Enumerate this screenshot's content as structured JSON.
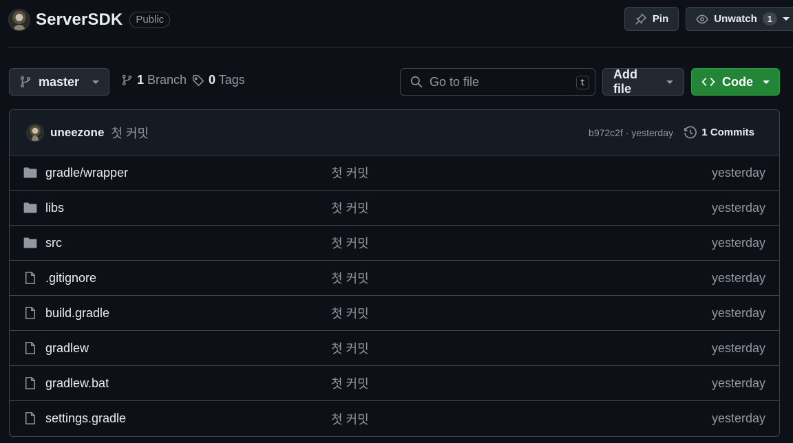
{
  "repo": {
    "name": "ServerSDK",
    "visibility": "Public"
  },
  "header_actions": {
    "pin_label": "Pin",
    "unwatch_label": "Unwatch",
    "watch_count": "1"
  },
  "toolbar": {
    "branch_name": "master",
    "branch_count": "1",
    "branch_label": "Branch",
    "tag_count": "0",
    "tag_label": "Tags",
    "goto_placeholder": "Go to file",
    "goto_shortcut": "t",
    "add_file_label": "Add file",
    "code_label": "Code"
  },
  "latest_commit": {
    "author": "uneezone",
    "message": "첫 커밋",
    "hash_time": "b972c2f · yesterday",
    "commits_count": "1",
    "commits_label": "Commits"
  },
  "files": [
    {
      "name": "gradle/wrapper",
      "type": "folder",
      "message": "첫 커밋",
      "time": "yesterday"
    },
    {
      "name": "libs",
      "type": "folder",
      "message": "첫 커밋",
      "time": "yesterday"
    },
    {
      "name": "src",
      "type": "folder",
      "message": "첫 커밋",
      "time": "yesterday"
    },
    {
      "name": ".gitignore",
      "type": "file",
      "message": "첫 커밋",
      "time": "yesterday"
    },
    {
      "name": "build.gradle",
      "type": "file",
      "message": "첫 커밋",
      "time": "yesterday"
    },
    {
      "name": "gradlew",
      "type": "file",
      "message": "첫 커밋",
      "time": "yesterday"
    },
    {
      "name": "gradlew.bat",
      "type": "file",
      "message": "첫 커밋",
      "time": "yesterday"
    },
    {
      "name": "settings.gradle",
      "type": "file",
      "message": "첫 커밋",
      "time": "yesterday"
    }
  ],
  "colors": {
    "background": "#0d1117",
    "accent_green": "#238636",
    "muted_text": "#9198a1",
    "border": "#3d444d"
  }
}
